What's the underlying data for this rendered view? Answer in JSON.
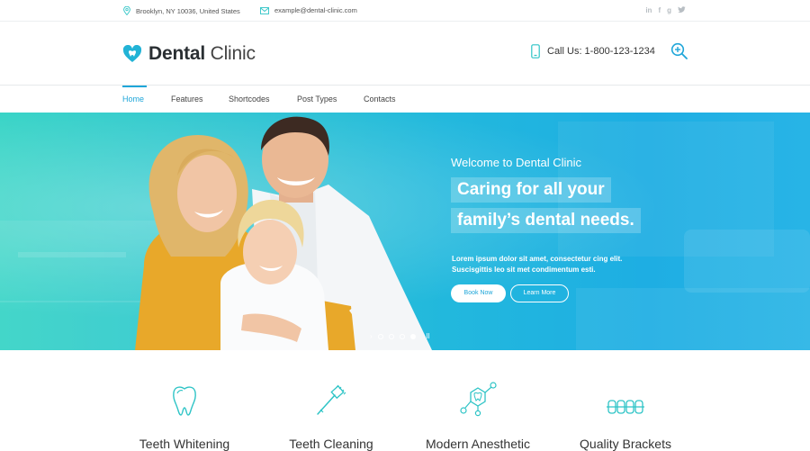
{
  "topbar": {
    "address": "Brooklyn, NY 10036, United States",
    "email": "example@dental-clinic.com",
    "socials": [
      "linkedin-icon",
      "facebook-icon",
      "google-plus-icon",
      "twitter-icon"
    ]
  },
  "header": {
    "logo_bold": "Dental",
    "logo_light": " Clinic",
    "call_label": "Call Us: 1-800-123-1234"
  },
  "nav": {
    "items": [
      "Home",
      "Features",
      "Shortcodes",
      "Post Types",
      "Contacts"
    ]
  },
  "hero": {
    "welcome": "Welcome to Dental Clinic",
    "headline_1": "Caring for all your",
    "headline_2": "family’s dental needs.",
    "lead_1": "Lorem ipsum dolor sit amet, consectetur cing elit.",
    "lead_2": "Suscisgittis leo sit met condimentum esti.",
    "book_label": "Book Now",
    "learn_label": "Learn More",
    "slide_count": 4,
    "active_slide": 4
  },
  "features": [
    {
      "title": "Teeth Whitening",
      "icon": "tooth-icon"
    },
    {
      "title": "Teeth Cleaning",
      "icon": "toothbrush-icon"
    },
    {
      "title": "Modern Anesthetic",
      "icon": "molecule-icon"
    },
    {
      "title": "Quality Brackets",
      "icon": "brackets-icon"
    }
  ],
  "colors": {
    "accent": "#1fa6d9",
    "hero_start": "#34d3c5",
    "hero_end": "#1eaee3"
  }
}
